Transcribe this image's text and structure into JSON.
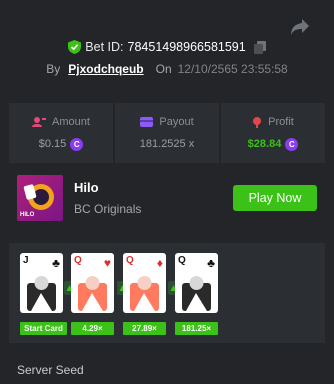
{
  "header": {
    "bet_id_label": "Bet ID:",
    "bet_id_value": "78451498966581591",
    "by_label": "By",
    "username": "Pjxodchqeub",
    "on_label": "On",
    "datetime": "12/10/2565 23:55:58"
  },
  "stats": {
    "amount_label": "Amount",
    "amount_value": "$0.15",
    "payout_label": "Payout",
    "payout_value": "181.2525 x",
    "profit_label": "Profit",
    "profit_value": "$28.84"
  },
  "game": {
    "title": "Hilo",
    "subtitle": "BC Originals",
    "thumb_text": "HILO",
    "play_label": "Play Now"
  },
  "cards": [
    {
      "rank": "J",
      "suit": "♣",
      "color": "#111111"
    },
    {
      "rank": "Q",
      "suit": "♥",
      "color": "#d9302b"
    },
    {
      "rank": "Q",
      "suit": "♦",
      "color": "#d9302b"
    },
    {
      "rank": "Q",
      "suit": "♣",
      "color": "#111111"
    }
  ],
  "multipliers": [
    "Start Card",
    "4.29×",
    "27.89×",
    "181.25×"
  ],
  "section": {
    "server_seed_label": "Server Seed"
  },
  "colors": {
    "accent_green": "#3bc117",
    "coin_purple": "#8a3cf2",
    "background": "#232528",
    "panel": "#2b2e33"
  },
  "icons": {
    "share": "share-icon",
    "shield": "shield-check-icon",
    "copy": "copy-icon",
    "amount": "amount-icon",
    "payout": "payout-icon",
    "profit": "profit-icon",
    "coin": "bcd-coin-icon"
  }
}
